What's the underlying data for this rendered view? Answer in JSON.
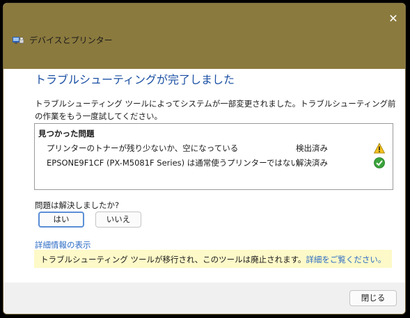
{
  "window": {
    "title": "デバイスとプリンター",
    "close_glyph": "✕"
  },
  "main": {
    "headline": "トラブルシューティングが完了しました",
    "description": "トラブルシューティング ツールによってシステムが一部変更されました。トラブルシューティング前の作業をもう一度試してください。"
  },
  "problems": {
    "heading": "見つかった問題",
    "items": [
      {
        "text": "プリンターのトナーが残り少ないか、空になっている",
        "status": "検出済み",
        "icon": "warning-icon"
      },
      {
        "text": "EPSONE9F1CF (PX-M5081F Series) は通常使うプリンターではない",
        "status": "解決済み",
        "icon": "check-icon"
      }
    ]
  },
  "question": {
    "text": "問題は解決しましたか?",
    "yes_label": "はい",
    "no_label": "いいえ"
  },
  "details_link": "詳細情報の表示",
  "notice": {
    "text": "トラブルシューティング ツールが移行され、このツールは廃止されます。",
    "link": "詳細をご覧ください。"
  },
  "footer": {
    "close_label": "閉じる"
  },
  "colors": {
    "titlebar": "#8b7a3e",
    "headline": "#1a4fa3",
    "link": "#2b6bc4",
    "notice_bg": "#fdf9c8",
    "footer_bg": "#f0f0f0"
  }
}
